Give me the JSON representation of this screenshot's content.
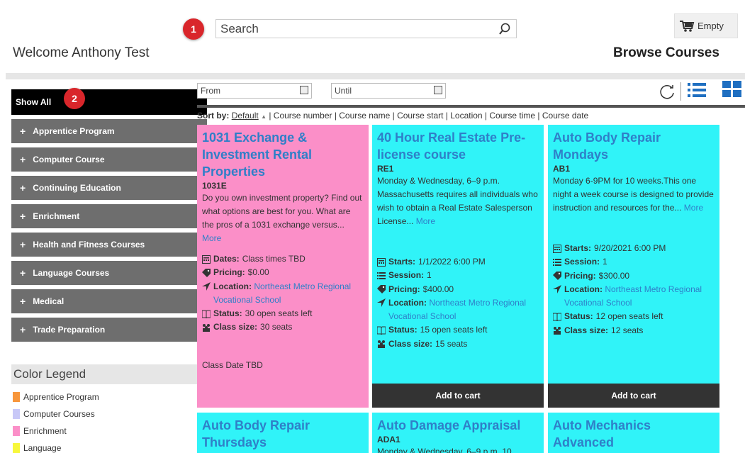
{
  "header": {
    "welcome": "Welcome Anthony Test",
    "page_title": "Browse Courses",
    "search_placeholder": "Search",
    "cart_label": "Empty",
    "marker_1": "1",
    "marker_2": "2"
  },
  "sidebar": {
    "show_all": "Show All",
    "categories": [
      {
        "label": "Apprentice Program"
      },
      {
        "label": "Computer Course"
      },
      {
        "label": "Continuing Education"
      },
      {
        "label": "Enrichment"
      },
      {
        "label": "Health and Fitness Courses"
      },
      {
        "label": "Language Courses"
      },
      {
        "label": "Medical"
      },
      {
        "label": "Trade Preparation"
      }
    ],
    "plus": "+"
  },
  "legend": {
    "title": "Color Legend",
    "items": [
      {
        "label": "Apprentice Program",
        "color": "#f7963b"
      },
      {
        "label": "Computer Courses",
        "color": "#c8c8f7"
      },
      {
        "label": "Enrichment",
        "color": "#fb8fc8"
      },
      {
        "label": "Language",
        "color": "#f7f73b"
      }
    ]
  },
  "filters": {
    "from": "From",
    "until": "Until"
  },
  "sort": {
    "label": "Sort by:",
    "default": "Default",
    "arrow": "▲",
    "options": "| Course number | Course name | Course start | Location | Course time | Course date"
  },
  "cards": [
    {
      "title": "1031 Exchange & Investment Rental Properties",
      "code": "1031E",
      "desc": "Do you own investment property? Find out what options are best for you. What are the pros of a 1031 exchange versus...",
      "more": "More",
      "dates_k": "Dates:",
      "dates_v": "Class times TBD",
      "pricing_k": "Pricing:",
      "pricing_v": "$0.00",
      "location_k": "Location:",
      "location_v": "Northeast Metro Regional Vocational School",
      "status_k": "Status:",
      "status_v": "30 open seats left",
      "size_k": "Class size:",
      "size_v": "30 seats",
      "tbd": "Class Date TBD",
      "color": "#fb8fc8"
    },
    {
      "title": "40 Hour Real Estate Pre-license course",
      "code": "RE1",
      "desc": "Monday & Wednesday, 6–9 p.m. Massachusetts requires all individuals who wish to obtain a Real Estate Salesperson License...",
      "more": "More",
      "starts_k": "Starts:",
      "starts_v": "1/1/2022 6:00 PM",
      "session_k": "Session:",
      "session_v": "1",
      "pricing_k": "Pricing:",
      "pricing_v": "$400.00",
      "location_k": "Location:",
      "location_v": "Northeast Metro Regional Vocational School",
      "status_k": "Status:",
      "status_v": "15 open seats left",
      "size_k": "Class size:",
      "size_v": "15 seats",
      "add": "Add to cart",
      "color": "#30f3f8"
    },
    {
      "title": "Auto Body Repair Mondays",
      "code": "AB1",
      "desc": "Monday 6-9PM for 10 weeks.This one night a week course is designed to provide instruction and resources for the...",
      "more": "More",
      "starts_k": "Starts:",
      "starts_v": "9/20/2021 6:00 PM",
      "session_k": "Session:",
      "session_v": "1",
      "pricing_k": "Pricing:",
      "pricing_v": "$300.00",
      "location_k": "Location:",
      "location_v": "Northeast Metro Regional Vocational School",
      "status_k": "Status:",
      "status_v": "12 open seats left",
      "size_k": "Class size:",
      "size_v": "12 seats",
      "add": "Add to cart",
      "color": "#30f3f8"
    },
    {
      "title": "Auto Body Repair Thursdays",
      "color": "#30f3f8"
    },
    {
      "title": "Auto Damage Appraisal",
      "code": "ADA1",
      "desc": "Monday & Wednesday, 6–9 p.m. 10",
      "color": "#30f3f8"
    },
    {
      "title": "Auto Mechanics Advanced",
      "color": "#30f3f8"
    }
  ]
}
